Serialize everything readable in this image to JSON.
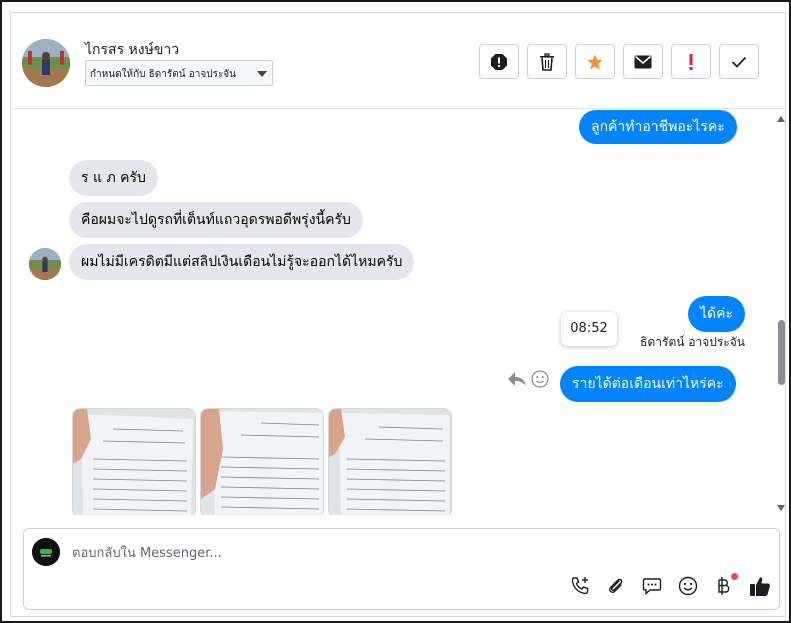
{
  "header": {
    "contact_name": "ไกรสร หงษ์ขาว",
    "assign_label": "กำหนดให้กับ ธิดารัตน์ อาจประจัน",
    "actions": [
      {
        "name": "spam-icon",
        "color": "#1c1e21"
      },
      {
        "name": "trash-icon",
        "color": "#1c1e21"
      },
      {
        "name": "star-icon",
        "color": "#f7923b"
      },
      {
        "name": "envelope-icon",
        "color": "#1c1e21"
      },
      {
        "name": "follow-up-icon",
        "color": "#e41e3f"
      },
      {
        "name": "check-icon",
        "color": "#1c1e21"
      }
    ]
  },
  "messages": {
    "m1": "ลูกค้าทำอาชีพอะไรคะ",
    "m2": "ร แ ภ ครับ",
    "m3": "คือผมจะไปดูรถที่เต็นท์แถวอุดรพอดีพรุ่งนี้ครับ",
    "m4": "ผมไม่มีเครดิตมีแต่สลิปเงินเดือนไม่รู้จะออกได้ไหมครับ",
    "m5": "ได้ค่ะ",
    "m6": "รายได้ต่อเดือนเท่าไหร่คะ",
    "sender_label": "ธิดารัตน์ อาจประจัน",
    "tooltip_time": "08:52"
  },
  "composer": {
    "placeholder": "ตอบกลับใน Messenger...",
    "tools": [
      "call-add-icon",
      "paperclip-icon",
      "saved-reply-icon",
      "emoji-icon",
      "baht-icon",
      "like-icon"
    ]
  },
  "colors": {
    "outgoing": "#0084ff",
    "incoming": "#e4e6eb",
    "accent_dot": "#f3425f"
  }
}
